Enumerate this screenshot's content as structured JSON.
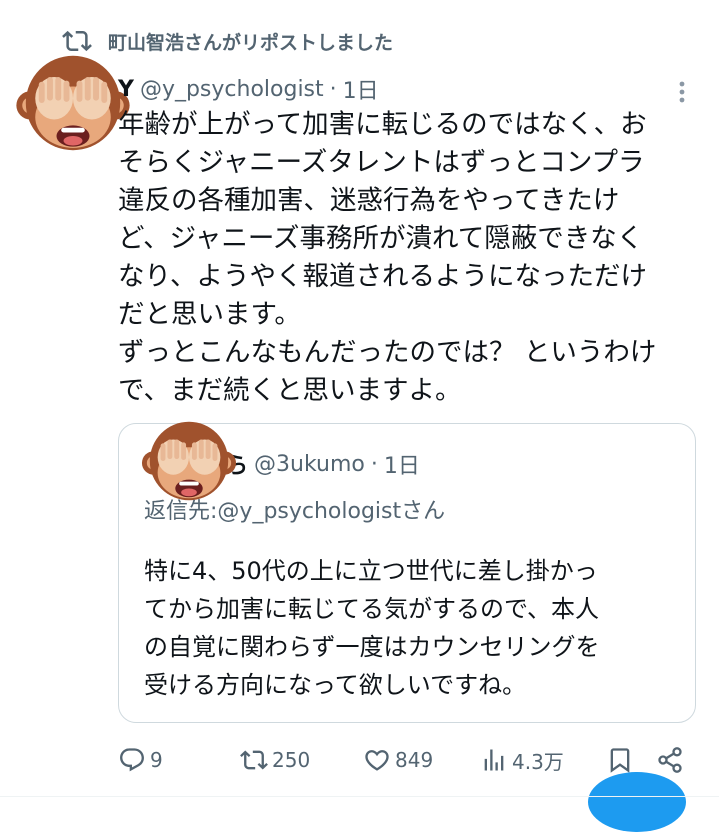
{
  "repost": {
    "label": "町山智浩さんがリポストしました",
    "icon": "repost-icon"
  },
  "tweet": {
    "name": "Y",
    "handle": "@y_psychologist",
    "separator": "·",
    "time": "1日",
    "lines": [
      "年齢が上がって加害に転じるのではなく、お",
      "そらくジャニーズタレントはずっとコンプラ",
      "違反の各種加害、迷惑行為をやってきたけ",
      "ど、ジャニーズ事務所が潰れて隠蔽できなく",
      "なり、ようやく報道されるようになっただけ",
      "だと思います。",
      "ずっとこんなもんだったのでは？ というわけ",
      "で、まだ続くと思いますよ。"
    ]
  },
  "quote": {
    "name": "ら",
    "handle": "@3ukumo",
    "separator": "·",
    "time": "1日",
    "replying_prefix": "返信先:",
    "replying_handle": "@y_psychologistさん",
    "lines": [
      "特に4、50代の上に立つ世代に差し掛かっ",
      "てから加害に転じてる気がするので、本人",
      "の自覚に関わらず一度はカウンセリングを",
      "受ける方向になって欲しいですね。"
    ]
  },
  "actions": {
    "replies": "9",
    "reposts": "250",
    "likes": "849",
    "views": "4.3万"
  },
  "colors": {
    "text": "#0f1419",
    "muted": "#536471",
    "accent": "#1d9bf0",
    "border": "#cfd9de"
  }
}
